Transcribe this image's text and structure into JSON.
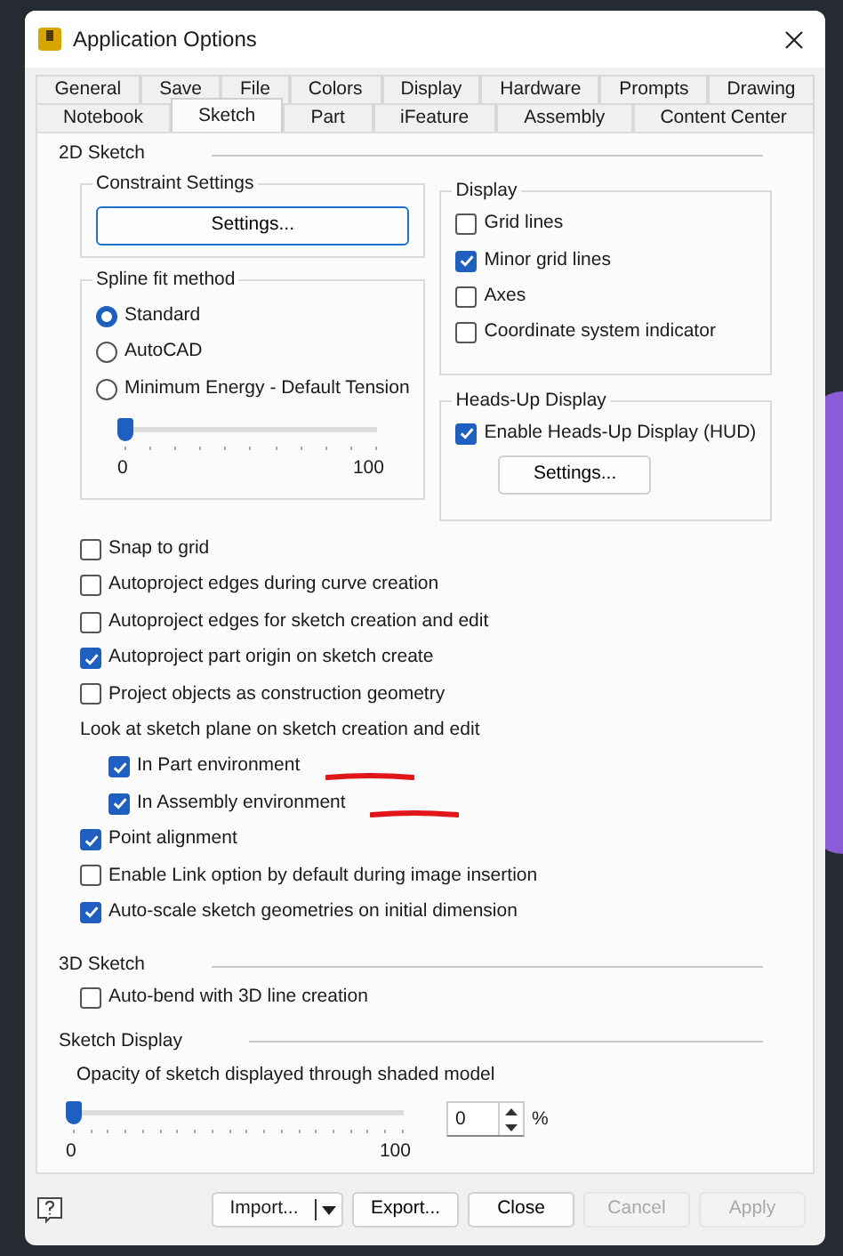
{
  "window": {
    "title": "Application Options"
  },
  "tab_rows": [
    [
      {
        "label": "General",
        "selected": false
      },
      {
        "label": "Save",
        "selected": false
      },
      {
        "label": "File",
        "selected": false
      },
      {
        "label": "Colors",
        "selected": false
      },
      {
        "label": "Display",
        "selected": false
      },
      {
        "label": "Hardware",
        "selected": false
      },
      {
        "label": "Prompts",
        "selected": false
      },
      {
        "label": "Drawing",
        "selected": false
      }
    ],
    [
      {
        "label": "Notebook",
        "selected": false
      },
      {
        "label": "Sketch",
        "selected": true
      },
      {
        "label": "Part",
        "selected": false
      },
      {
        "label": "iFeature",
        "selected": false
      },
      {
        "label": "Assembly",
        "selected": false
      },
      {
        "label": "Content Center",
        "selected": false
      }
    ]
  ],
  "sketch_2d": {
    "title": "2D Sketch",
    "constraint_settings": {
      "title": "Constraint Settings",
      "button": "Settings..."
    },
    "spline_fit": {
      "title": "Spline fit method",
      "options": [
        {
          "label": "Standard",
          "selected": true
        },
        {
          "label": "AutoCAD",
          "selected": false
        },
        {
          "label": "Minimum Energy - Default Tension",
          "selected": false
        }
      ],
      "slider": {
        "level": 0,
        "min_label": "0",
        "max_label": "100"
      }
    },
    "display": {
      "title": "Display",
      "checkboxes": [
        {
          "label": "Grid lines",
          "checked": false
        },
        {
          "label": "Minor grid lines",
          "checked": true
        },
        {
          "label": "Axes",
          "checked": false
        },
        {
          "label": "Coordinate system indicator",
          "checked": false
        }
      ]
    },
    "heads_up": {
      "title": "Heads-Up Display",
      "checkboxes": [
        {
          "label": "Enable Heads-Up Display (HUD)",
          "checked": true
        }
      ],
      "button": "Settings..."
    },
    "options": [
      {
        "kind": "checkbox",
        "label": "Snap to grid",
        "checked": false
      },
      {
        "kind": "checkbox",
        "label": "Autoproject edges during curve creation",
        "checked": false
      },
      {
        "kind": "checkbox",
        "label": "Autoproject edges for sketch creation and edit",
        "checked": false
      },
      {
        "kind": "checkbox",
        "label": "Autoproject part origin on sketch create",
        "checked": true
      },
      {
        "kind": "checkbox",
        "label": "Project objects as construction geometry",
        "checked": false
      },
      {
        "kind": "group",
        "label": "Look at sketch plane on sketch creation and edit",
        "children": [
          {
            "kind": "checkbox",
            "label": "In Part environment",
            "checked": true,
            "underlined": true
          },
          {
            "kind": "checkbox",
            "label": "In Assembly environment",
            "checked": true,
            "underlined": true
          }
        ]
      },
      {
        "kind": "checkbox",
        "label": "Point alignment",
        "checked": true
      },
      {
        "kind": "checkbox",
        "label": "Enable Link option by default during image insertion",
        "checked": false
      },
      {
        "kind": "checkbox",
        "label": "Auto-scale sketch geometries on initial dimension",
        "checked": true
      }
    ]
  },
  "sketch_3d": {
    "title": "3D Sketch",
    "options": [
      {
        "kind": "checkbox",
        "label": "Auto-bend with 3D line creation",
        "checked": false
      }
    ]
  },
  "sketch_display": {
    "title": "Sketch Display",
    "label": "Opacity of sketch displayed through shaded model",
    "slider": {
      "level": 0,
      "min_label": "0",
      "max_label": "100"
    },
    "spin_value": "0",
    "unit": "%"
  },
  "footer_buttons": [
    {
      "kind": "split",
      "label": "Import...",
      "disabled": false
    },
    {
      "kind": "plain",
      "label": "Export...",
      "disabled": false
    },
    {
      "kind": "plain",
      "label": "Close",
      "disabled": false
    },
    {
      "kind": "plain",
      "label": "Cancel",
      "disabled": true
    },
    {
      "kind": "plain",
      "label": "Apply",
      "disabled": true
    }
  ]
}
